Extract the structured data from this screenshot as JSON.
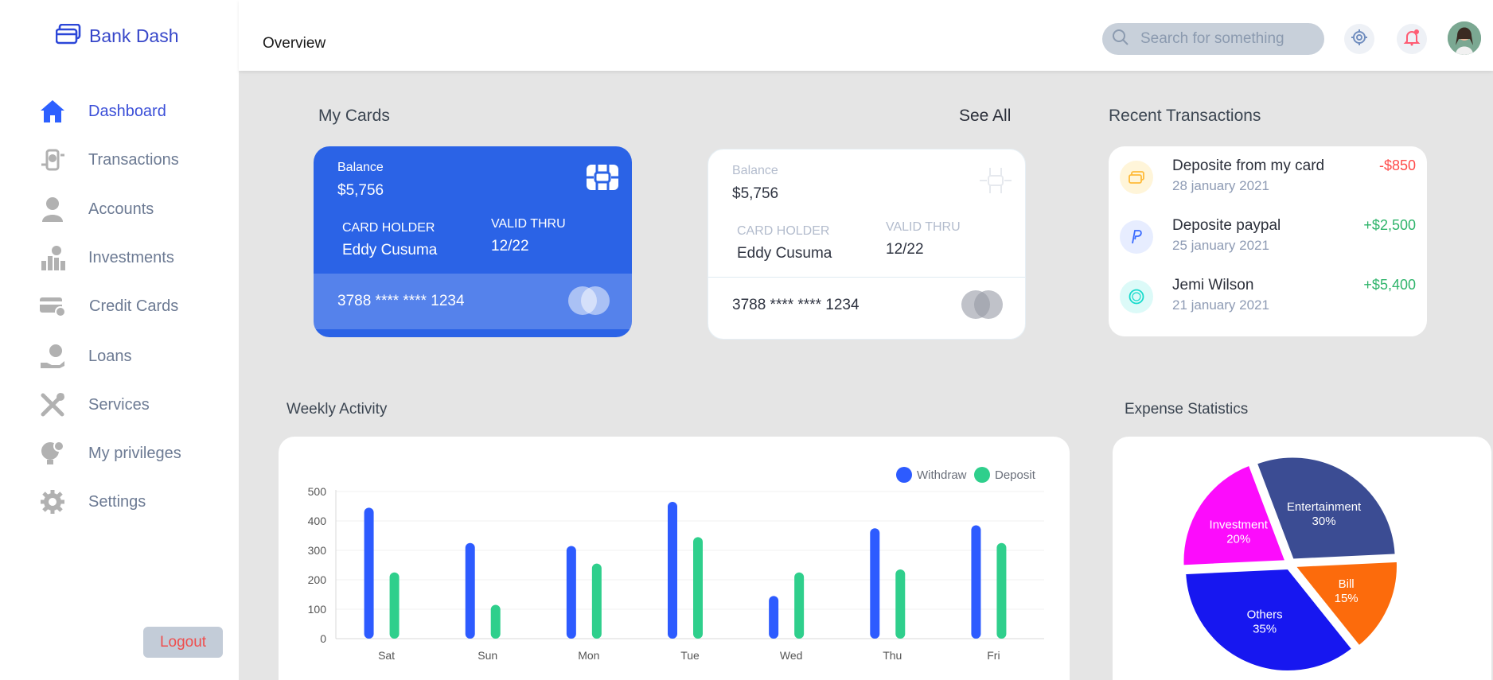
{
  "brand": {
    "name": "Bank Dash"
  },
  "sidebar": {
    "items": [
      {
        "label": "Dashboard",
        "icon": "home-icon",
        "active": true
      },
      {
        "label": "Transactions",
        "icon": "transfer-icon"
      },
      {
        "label": "Accounts",
        "icon": "user-icon"
      },
      {
        "label": "Investments",
        "icon": "investments-icon"
      },
      {
        "label": "Credit Cards",
        "icon": "credit-card-icon"
      },
      {
        "label": "Loans",
        "icon": "loan-icon"
      },
      {
        "label": "Services",
        "icon": "services-icon"
      },
      {
        "label": "My privileges",
        "icon": "lightbulb-icon"
      },
      {
        "label": "Settings",
        "icon": "settings-icon"
      }
    ],
    "logout_label": "Logout"
  },
  "header": {
    "title": "Overview",
    "search_placeholder": "Search for something"
  },
  "my_cards": {
    "title": "My Cards",
    "see_all": "See All",
    "cards": [
      {
        "balance_label": "Balance",
        "balance": "$5,756",
        "holder_label": "CARD HOLDER",
        "holder": "Eddy Cusuma",
        "valid_label": "VALID THRU",
        "valid": "12/22",
        "number": "3788 **** **** 1234"
      },
      {
        "balance_label": "Balance",
        "balance": "$5,756",
        "holder_label": "CARD HOLDER",
        "holder": "Eddy Cusuma",
        "valid_label": "VALID THRU",
        "valid": "12/22",
        "number": "3788 **** **** 1234"
      }
    ]
  },
  "recent_transactions": {
    "title": "Recent Transactions",
    "items": [
      {
        "title": "Deposite from my card",
        "date": "28 january 2021",
        "amount": "-$850",
        "icon": "card-icon",
        "color": "#ff4b4a"
      },
      {
        "title": "Deposite paypal",
        "date": "25 january 2021",
        "amount": "+$2,500",
        "icon": "paypal-icon",
        "color": "#41d4a8"
      },
      {
        "title": "Jemi Wilson",
        "date": "21 january 2021",
        "amount": "+$5,400",
        "icon": "dollar-icon",
        "color": "#41d4a8"
      }
    ]
  },
  "weekly_activity": {
    "title": "Weekly Activity"
  },
  "expense_statistics": {
    "title": "Expense Statistics"
  },
  "chart_data": [
    {
      "type": "bar",
      "categories": [
        "Sat",
        "Sun",
        "Mon",
        "Tue",
        "Wed",
        "Thu",
        "Fri"
      ],
      "series": [
        {
          "name": "Withdraw",
          "color": "#2d5bff",
          "values": [
            445,
            325,
            315,
            465,
            145,
            375,
            385
          ]
        },
        {
          "name": "Deposit",
          "color": "#2fcf8c",
          "values": [
            225,
            115,
            255,
            345,
            225,
            235,
            325
          ]
        }
      ],
      "yticks": [
        0,
        100,
        200,
        300,
        400,
        500
      ],
      "ylim": [
        0,
        500
      ],
      "legend": "top-right"
    },
    {
      "type": "pie",
      "slices": [
        {
          "label": "Entertainment",
          "value": 30,
          "color": "#3b4c93"
        },
        {
          "label": "Bill",
          "value": 15,
          "color": "#fc6b0c"
        },
        {
          "label": "Others",
          "value": 35,
          "color": "#1717f0"
        },
        {
          "label": "Investment",
          "value": 20,
          "color": "#fc0cfc"
        }
      ]
    }
  ]
}
